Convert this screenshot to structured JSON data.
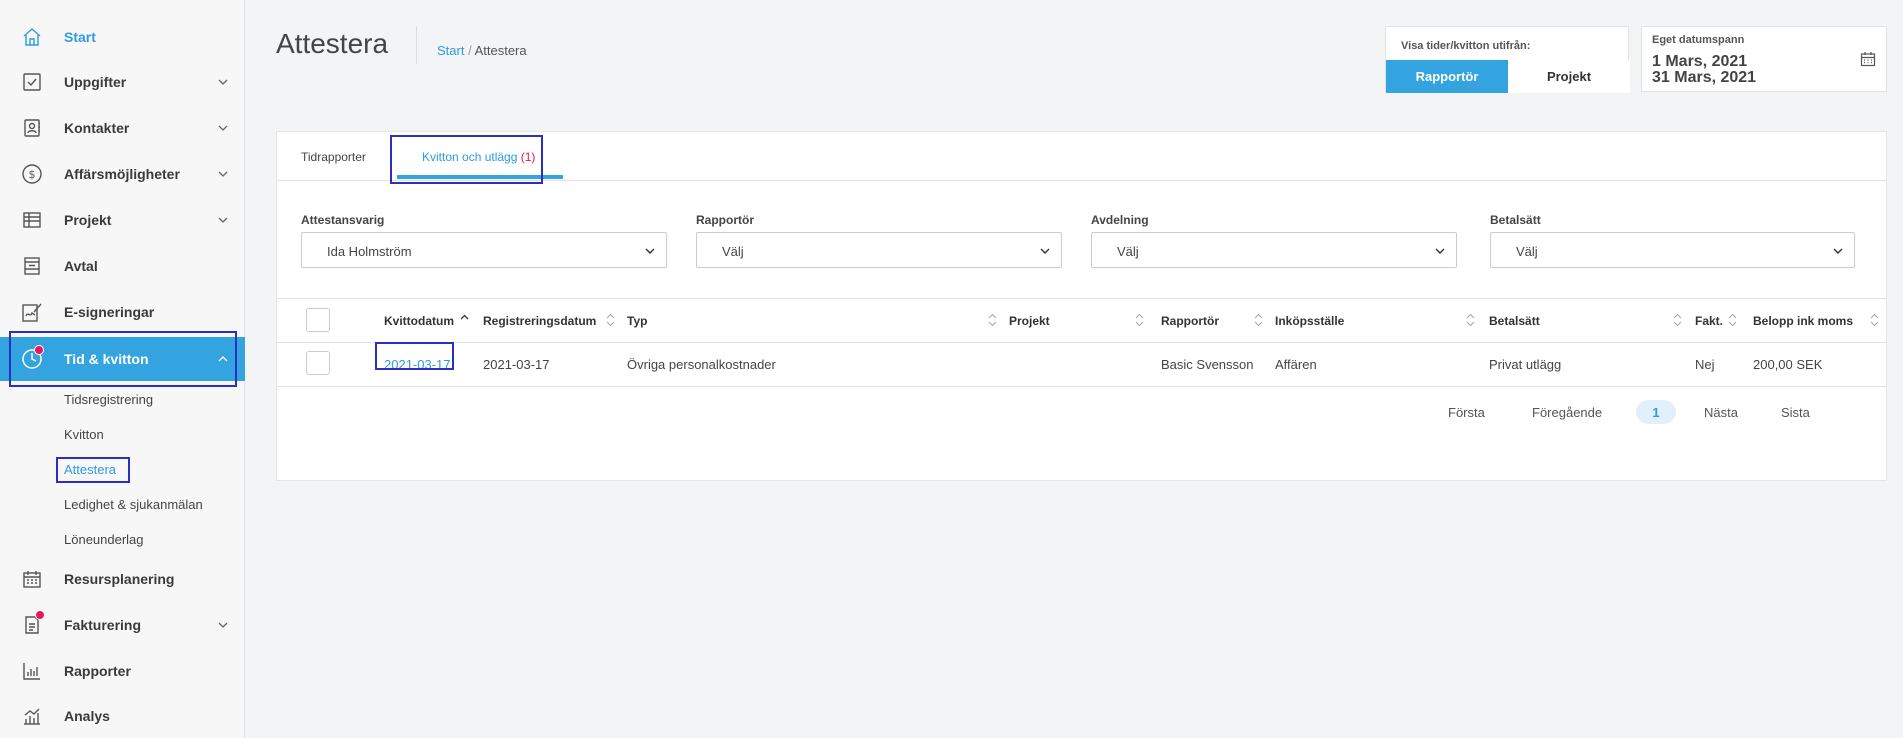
{
  "sidebar": {
    "items": [
      {
        "label": "Start",
        "icon": "home-icon"
      },
      {
        "label": "Uppgifter",
        "icon": "checkbox-icon"
      },
      {
        "label": "Kontakter",
        "icon": "contacts-icon"
      },
      {
        "label": "Affärsmöjligheter",
        "icon": "dollar-icon"
      },
      {
        "label": "Projekt",
        "icon": "table-icon"
      },
      {
        "label": "Avtal",
        "icon": "contract-icon"
      },
      {
        "label": "E-signeringar",
        "icon": "signature-icon"
      },
      {
        "label": "Tid & kvitton",
        "icon": "clock-icon"
      },
      {
        "label": "Resursplanering",
        "icon": "calendar-icon"
      },
      {
        "label": "Fakturering",
        "icon": "invoice-icon"
      },
      {
        "label": "Rapporter",
        "icon": "bar-chart-icon"
      },
      {
        "label": "Analys",
        "icon": "analytics-icon"
      }
    ],
    "subitems": [
      {
        "label": "Tidsregistrering"
      },
      {
        "label": "Kvitton"
      },
      {
        "label": "Attestera"
      },
      {
        "label": "Ledighet & sjukanmälan"
      },
      {
        "label": "Löneunderlag"
      }
    ]
  },
  "header": {
    "title": "Attestera",
    "breadcrumb": {
      "home": "Start",
      "separator": " / ",
      "current": "Attestera"
    }
  },
  "view_toggle": {
    "label": "Visa tider/kvitton utifrån:",
    "options": [
      "Rapportör",
      "Projekt"
    ],
    "selected": "Rapportör"
  },
  "date_range": {
    "label": "Eget datumspann",
    "from": "1 Mars, 2021",
    "to": "31 Mars, 2021"
  },
  "tabs": [
    {
      "label": "Tidrapporter"
    },
    {
      "label": "Kvitton och utlägg",
      "count": "(1)"
    }
  ],
  "filters": [
    {
      "label": "Attestansvarig",
      "value": "Ida Holmström"
    },
    {
      "label": "Rapportör",
      "value": "Välj"
    },
    {
      "label": "Avdelning",
      "value": "Välj"
    },
    {
      "label": "Betalsätt",
      "value": "Välj"
    }
  ],
  "table": {
    "columns": [
      "Kvittodatum",
      "Registreringsdatum",
      "Typ",
      "Projekt",
      "Rapportör",
      "Inköpsställe",
      "Betalsätt",
      "Fakt.",
      "Belopp ink moms"
    ],
    "rows": [
      {
        "kvittodatum": "2021-03-17",
        "registreringsdatum": "2021-03-17",
        "typ": "Övriga personalkostnader",
        "projekt": "",
        "rapportor": "Basic Svensson",
        "inkopsstalle": "Affären",
        "betalsatt": "Privat utlägg",
        "fakt": "Nej",
        "belopp": "200,00 SEK"
      }
    ]
  },
  "pagination": {
    "first": "Första",
    "prev": "Föregående",
    "current": "1",
    "next": "Nästa",
    "last": "Sista"
  },
  "colors": {
    "accent": "#33a4e0",
    "link": "#2e9be0",
    "badge": "#e8175d",
    "highlight_box": "#2b2fbf"
  }
}
